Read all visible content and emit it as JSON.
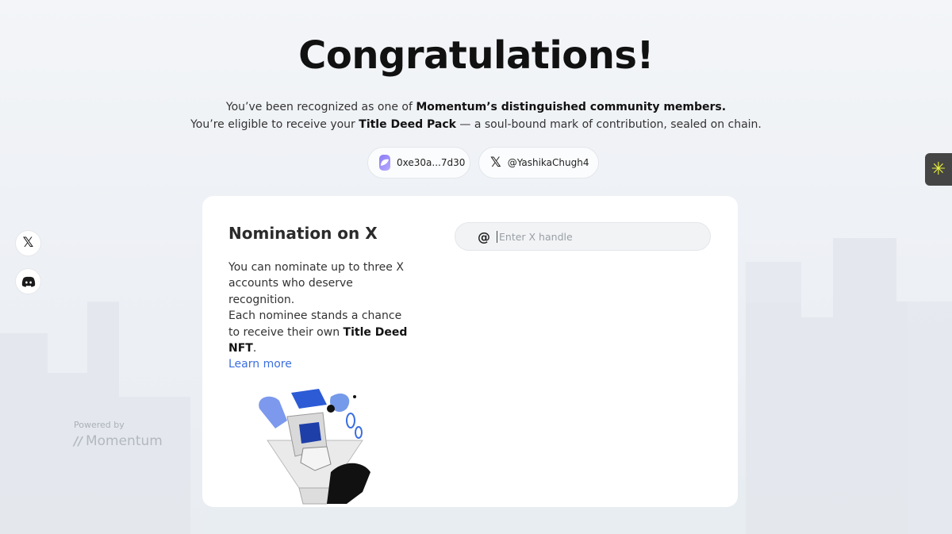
{
  "header": {
    "title": "Congratulations!",
    "line1_prefix": "You’ve been recognized as one of ",
    "line1_bold": "Momentum’s distinguished community members.",
    "line2_prefix": "You’re eligible to receive your ",
    "line2_bold": "Title Deed Pack",
    "line2_suffix": " — a soul-bound mark of contribution, sealed on chain."
  },
  "chips": {
    "wallet": "0xe30a...7d30",
    "x_handle": "@YashikaChugh4"
  },
  "side": {
    "x_icon": "x-icon",
    "discord_icon": "discord-icon"
  },
  "powered": {
    "label": "Powered by",
    "brand": "Momentum"
  },
  "card": {
    "title": "Nomination on X",
    "desc_1": "You can nominate up to three X accounts who deserve recognition.",
    "desc_2_prefix": "Each nominee stands a chance to receive their own ",
    "desc_2_bold": "Title Deed NFT",
    "desc_2_suffix": ".",
    "learn_more": "Learn more",
    "input_placeholder": "Enter X handle",
    "input_value": ""
  },
  "colors": {
    "accent_link": "#3b6fe0",
    "widget_bg": "#454545",
    "widget_icon": "#e9f23b"
  }
}
